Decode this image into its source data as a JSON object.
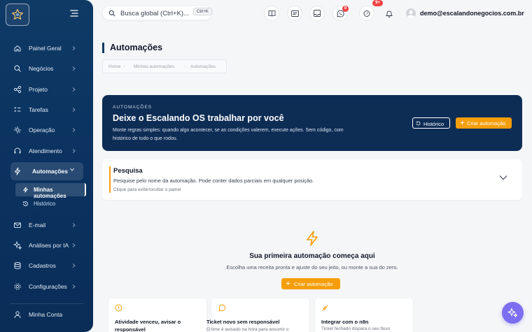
{
  "colors": {
    "sidebar": "#0f3a66",
    "accent": "#f59e0b",
    "hero": "#0d2d55",
    "badge": "#ef4444",
    "fab": "#7c6ef0"
  },
  "sidebar": {
    "logo_icon": "star-logo-icon",
    "items": [
      {
        "label": "Painel Geral",
        "icon": "home-icon"
      },
      {
        "label": "Negócios",
        "icon": "search-icon"
      },
      {
        "label": "Projeto",
        "icon": "diagram-icon"
      },
      {
        "label": "Tarefas",
        "icon": "checklist-icon"
      },
      {
        "label": "Operação",
        "icon": "operation-icon"
      },
      {
        "label": "Atendimento",
        "icon": "headset-icon"
      },
      {
        "label": "Automações",
        "icon": "bolt-icon"
      },
      {
        "label": "E-mail",
        "icon": "mail-icon"
      },
      {
        "label": "Análises por IA",
        "icon": "sparkle-icon"
      },
      {
        "label": "Cadastros",
        "icon": "database-icon"
      },
      {
        "label": "Configurações",
        "icon": "gear-icon"
      },
      {
        "label": "Minha Conta",
        "icon": "user-icon"
      }
    ],
    "sub_items": [
      {
        "label": "Minhas automações",
        "icon": "bolt-icon"
      },
      {
        "label": "Histórico",
        "icon": "history-icon"
      }
    ]
  },
  "topbar": {
    "search_placeholder": "Busca global (Ctrl+K)...",
    "shortcut": "Ctrl+K",
    "icons": [
      "book-icon",
      "card-icon",
      "inbox-icon",
      "whatsapp-icon",
      "timer-icon",
      "bell-icon"
    ],
    "whatsapp_badge": "0",
    "notifications_badge": "9+",
    "user_email": "demo@escalandonegocios.com.br"
  },
  "page": {
    "title": "Automações",
    "breadcrumb": [
      "Home",
      "Minhas automações",
      "Automações"
    ]
  },
  "hero": {
    "kicker": "AUTOMAÇÕES",
    "title": "Deixe o Escalando OS trabalhar por você",
    "description": "Monte regras simples: quando algo acontecer, se as condições valerem, execute ações. Sem código, com histórico de tudo o que rodou.",
    "history_button": "Histórico",
    "create_button": "Criar automação"
  },
  "search_panel": {
    "title": "Pesquisa",
    "description": "Pesquise pelo nome da automação. Pode conter dados parciais em qualquer posição.",
    "hint": "Clique para exibir/ocultar o painel"
  },
  "empty_state": {
    "title": "Sua primeira automação começa aqui",
    "subtitle": "Escolha uma receita pronta e ajuste do seu jeito, ou monte a sua do zero.",
    "button": "Criar automação"
  },
  "recipes": [
    {
      "title": "Atividade venceu, avisar o responsável",
      "desc": "",
      "icon": "alert-icon"
    },
    {
      "title": "Ticket novo sem responsável",
      "desc": "O time é avisado na hora para assumir o",
      "icon": "chat-icon"
    },
    {
      "title": "Integrar com o n8n",
      "desc": "Ticket fechado dispara o seu fluxo",
      "icon": "plug-icon"
    }
  ]
}
